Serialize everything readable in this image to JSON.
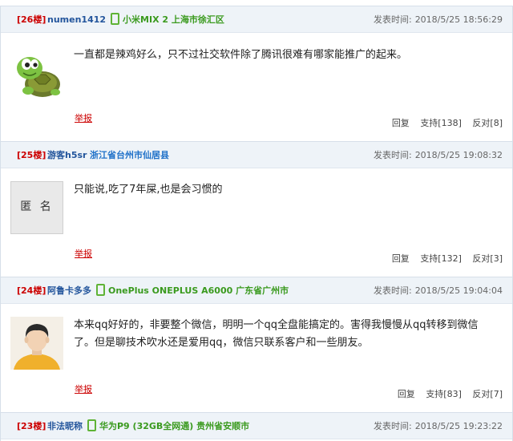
{
  "time_label": "发表时间:",
  "report_label": "举报",
  "reply_label": "回复",
  "posts": [
    {
      "floor": "[26楼]",
      "user": "numen1412",
      "device_location": "小米MIX 2 上海市徐汇区",
      "time": "2018/5/25 18:56:29",
      "avatar": "turtle",
      "content": "一直都是辣鸡好么，只不过社交软件除了腾讯很难有哪家能推广的起来。",
      "support": "支持[138]",
      "oppose": "反对[8]"
    },
    {
      "floor": "[25楼]",
      "user": "游客h5sr",
      "location": "浙江省台州市仙居县",
      "time": "2018/5/25 19:08:32",
      "avatar": "anonymous",
      "avatar_text": "匿 名",
      "content": "只能说,吃了7年屎,也是会习惯的",
      "support": "支持[132]",
      "oppose": "反对[3]"
    },
    {
      "floor": "[24楼]",
      "user": "阿鲁卡多多",
      "device_location": "OnePlus ONEPLUS A6000 广东省广州市",
      "time": "2018/5/25 19:04:04",
      "avatar": "person",
      "content": "本来qq好好的，非要整个微信，明明一个qq全盘能搞定的。害得我慢慢从qq转移到微信了。但是聊技术吹水还是爱用qq，微信只联系客户和一些朋友。",
      "support": "支持[83]",
      "oppose": "反对[7]"
    },
    {
      "floor": "[23楼]",
      "user": "非法昵称",
      "device_location": "华为P9 (32GB全网通) 贵州省安顺市",
      "time": "2018/5/25 19:23:22"
    }
  ]
}
